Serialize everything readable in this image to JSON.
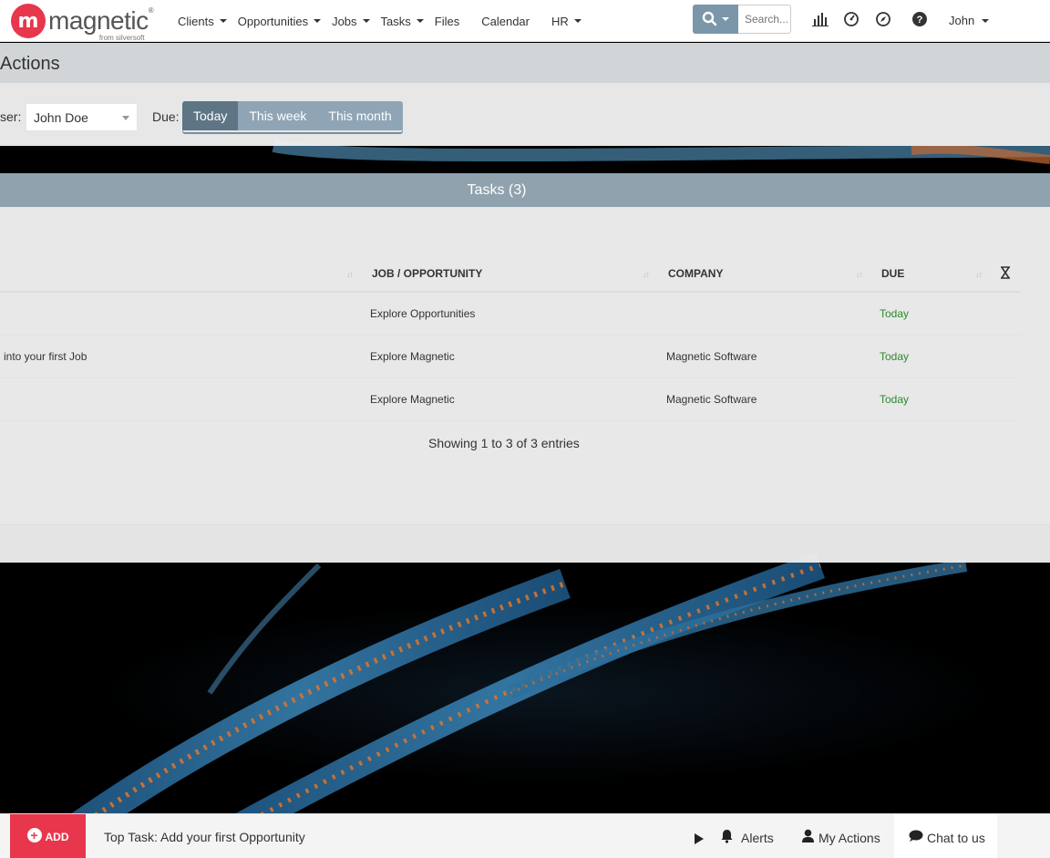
{
  "app": {
    "logo_mark": "m",
    "logo_word": "magnetic",
    "logo_sub": "from silversoft",
    "logo_reg": "®"
  },
  "nav": {
    "items": [
      {
        "label": "Clients",
        "dropdown": true
      },
      {
        "label": "Opportunities",
        "dropdown": true
      },
      {
        "label": "Jobs",
        "dropdown": true
      },
      {
        "label": "Tasks",
        "dropdown": true
      },
      {
        "label": "Files",
        "dropdown": false
      },
      {
        "label": "Calendar",
        "dropdown": false
      },
      {
        "label": "HR",
        "dropdown": true
      }
    ],
    "search_placeholder": "Search...",
    "icons": [
      "bar-chart-icon",
      "dashboard-icon",
      "compass-icon",
      "help-icon"
    ],
    "user": "John"
  },
  "actions": {
    "title": "Actions",
    "user_label": "ser:",
    "user_value": "John Doe",
    "due_label": "Due:",
    "due_options": [
      "Today",
      "This week",
      "This month"
    ],
    "due_selected": "Today"
  },
  "tasks": {
    "title": "Tasks (3)",
    "columns": [
      "JOB / OPPORTUNITY",
      "COMPANY",
      "DUE"
    ],
    "rows": [
      {
        "task": "",
        "job": "Explore Opportunities",
        "company": "",
        "due": "Today"
      },
      {
        "task": "into your first Job",
        "job": "Explore Magnetic",
        "company": "Magnetic Software",
        "due": "Today"
      },
      {
        "task": "",
        "job": "Explore Magnetic",
        "company": "Magnetic Software",
        "due": "Today"
      }
    ],
    "showing": "Showing 1 to 3 of 3 entries"
  },
  "bottom": {
    "add_label": "ADD",
    "top_task": "Top Task: Add your first Opportunity",
    "alerts": "Alerts",
    "my_actions": "My Actions",
    "chat": "Chat to us"
  },
  "colors": {
    "brand": "#e8364c",
    "due_green": "#2c8a2c",
    "tasks_bar": "#94a7b4",
    "btn_active": "#5d7585"
  }
}
